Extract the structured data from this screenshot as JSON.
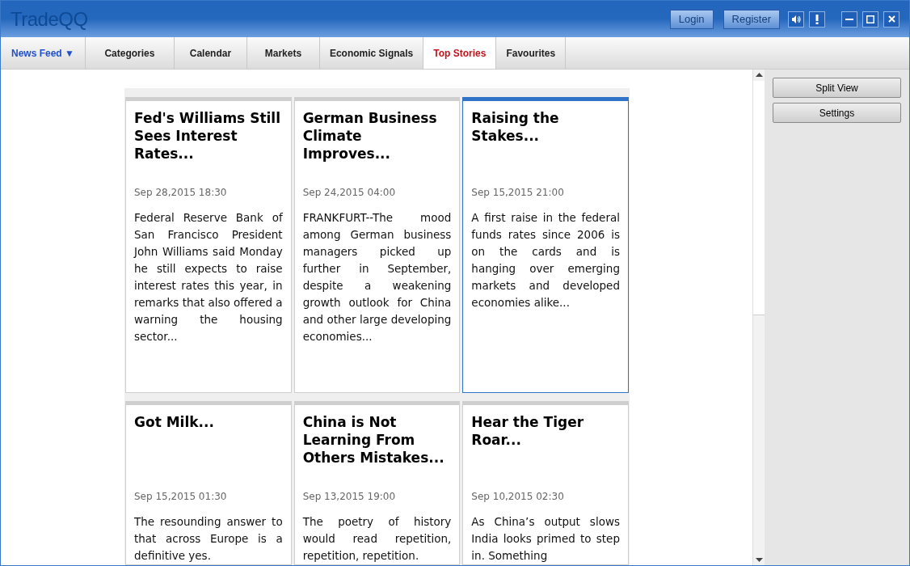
{
  "app": {
    "logo": "TradeQQ"
  },
  "header_buttons": [
    "Login",
    "Register"
  ],
  "tabs": [
    {
      "label": "News Feed ▼",
      "kind": "menu",
      "selected": false
    },
    {
      "label": "Categories",
      "kind": "tab",
      "selected": false
    },
    {
      "label": "Calendar",
      "kind": "tab",
      "selected": false
    },
    {
      "label": "Markets",
      "kind": "tab",
      "selected": false
    },
    {
      "label": "Economic Signals",
      "kind": "tab",
      "selected": false
    },
    {
      "label": "Top Stories",
      "kind": "tab",
      "selected": true
    },
    {
      "label": "Favourites",
      "kind": "tab",
      "selected": false
    }
  ],
  "stories": [
    {
      "title": "Fed's Williams Still Sees Interest Rates...",
      "date": "Sep 28,2015 18:30",
      "summary": "Federal Reserve Bank of San Francisco President John Williams said Monday he still expects to raise interest rates this year, in remarks that also offered a warning the housing sector...",
      "selected": false
    },
    {
      "title": "German Business Climate Improves...",
      "date": "Sep 24,2015 04:00",
      "summary": "FRANKFURT--The mood among German business managers picked up further in September, despite a weakening growth outlook for China and other large developing economies...",
      "selected": false
    },
    {
      "title": "Raising the Stakes...",
      "date": "Sep 15,2015 21:00",
      "summary": "A first raise in the federal funds rates since 2006 is on the cards and is hanging over emerging markets and developed economies alike...",
      "selected": true
    },
    {
      "title": "Got Milk...",
      "date": "Sep 15,2015 01:30",
      "summary": "The resounding answer to that across Europe is a definitive yes.",
      "selected": false
    },
    {
      "title": "China is Not Learning From Others Mistakes...",
      "date": "Sep 13,2015 19:00",
      "summary": "The poetry of history would read repetition, repetition, repetition.",
      "selected": false
    },
    {
      "title": "Hear the Tiger Roar...",
      "date": "Sep 10,2015 02:30",
      "summary": "As China’s output slows India looks primed to step in. Something",
      "selected": false
    }
  ],
  "side_buttons": [
    "Split View",
    "Settings"
  ]
}
